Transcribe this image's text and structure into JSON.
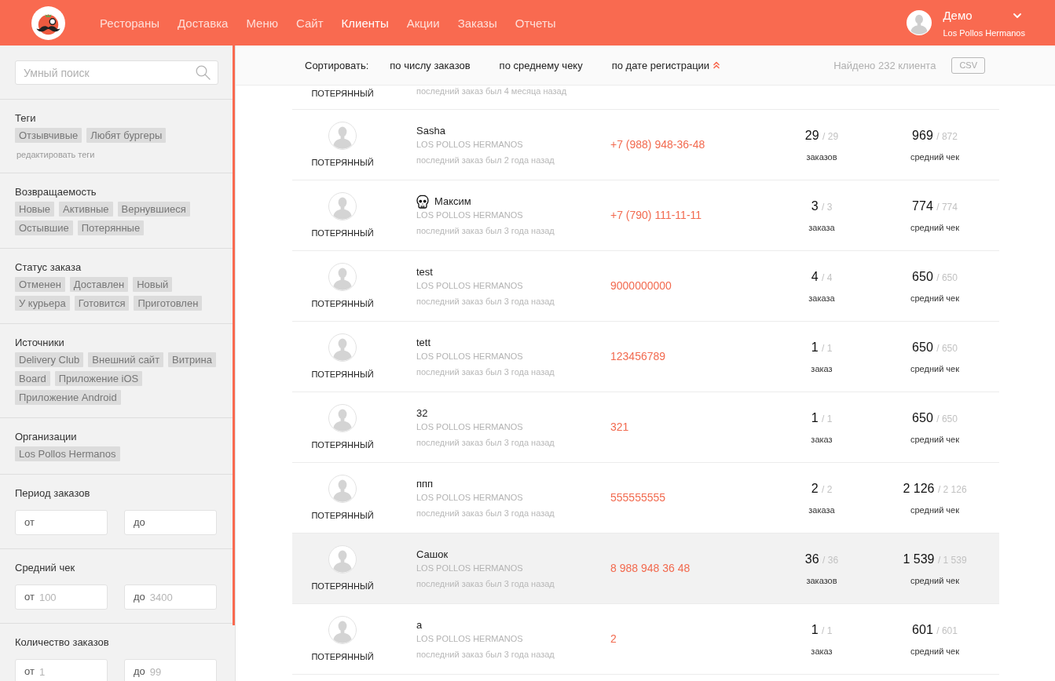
{
  "header": {
    "nav": [
      {
        "label": "Рестораны",
        "selected": false
      },
      {
        "label": "Доставка",
        "selected": false
      },
      {
        "label": "Меню",
        "selected": false
      },
      {
        "label": "Сайт",
        "selected": false
      },
      {
        "label": "Клиенты",
        "selected": true
      },
      {
        "label": "Акции",
        "selected": false
      },
      {
        "label": "Заказы",
        "selected": false
      },
      {
        "label": "Отчеты",
        "selected": false
      }
    ],
    "user": {
      "name": "Демо",
      "organization": "Los Pollos Hermanos"
    }
  },
  "sidebar": {
    "search": {
      "placeholder": "Умный поиск"
    },
    "filters": [
      {
        "kind": "tags",
        "title": "Теги",
        "tags": [
          "Отзывчивые",
          "Любят бургеры"
        ],
        "edit_link": "редактировать теги"
      },
      {
        "kind": "tags",
        "title": "Возвращаемость",
        "tags": [
          "Новые",
          "Активные",
          "Вернувшиеся",
          "Остывшие",
          "Потерянные"
        ]
      },
      {
        "kind": "tags",
        "title": "Статус заказа",
        "tags": [
          "Отменен",
          "Доставлен",
          "Новый",
          "У курьера",
          "Готовится",
          "Приготовлен"
        ]
      },
      {
        "kind": "tags",
        "title": "Источники",
        "tags": [
          "Delivery Club",
          "Внешний сайт",
          "Витрина",
          "Board",
          "Приложение iOS",
          "Приложение Android"
        ]
      },
      {
        "kind": "tags",
        "title": "Организации",
        "tags": [
          "Los Pollos Hermanos"
        ]
      },
      {
        "kind": "range",
        "title": "Период заказов",
        "fields": [
          {
            "prefix": "от"
          },
          {
            "prefix": "до"
          }
        ]
      },
      {
        "kind": "range",
        "title": "Средний чек",
        "fields": [
          {
            "prefix": "от",
            "placeholder": "100"
          },
          {
            "prefix": "до",
            "placeholder": "3400"
          }
        ]
      },
      {
        "kind": "range",
        "title": "Количество заказов",
        "fields": [
          {
            "prefix": "от",
            "placeholder": "1"
          },
          {
            "prefix": "до",
            "placeholder": "99"
          }
        ]
      }
    ]
  },
  "sort_bar": {
    "label": "Сортировать:",
    "options": [
      {
        "label": "по числу заказов",
        "selected": false
      },
      {
        "label": "по среднему чеку",
        "selected": false
      },
      {
        "label": "по дате регистрации",
        "selected": true
      }
    ],
    "found": "Найдено 232 клиента",
    "export_button": "CSV"
  },
  "clipped_row": {
    "status": "ПОТЕРЯННЫЙ",
    "last_order": "последний заказ был 4 месяца назад"
  },
  "clients": [
    {
      "name": "Sasha",
      "flagged": false,
      "company": "LOS POLLOS HERMANOS",
      "last_order": "последний заказ был 2 года назад",
      "status": "ПОТЕРЯННЫЙ",
      "phone": "+7 (988) 948-36-48",
      "orders": "29",
      "orders_all": "/ 29",
      "orders_label": "заказов",
      "avg": "969",
      "avg_all": "/ 872",
      "avg_label": "средний чек",
      "selected": false
    },
    {
      "name": "Максим",
      "flagged": true,
      "company": "LOS POLLOS HERMANOS",
      "last_order": "последний заказ был 3 года назад",
      "status": "ПОТЕРЯННЫЙ",
      "phone": "+7 (790) 111-11-11",
      "orders": "3",
      "orders_all": "/ 3",
      "orders_label": "заказа",
      "avg": "774",
      "avg_all": "/ 774",
      "avg_label": "средний чек",
      "selected": false
    },
    {
      "name": "test",
      "flagged": false,
      "company": "LOS POLLOS HERMANOS",
      "last_order": "последний заказ был 3 года назад",
      "status": "ПОТЕРЯННЫЙ",
      "phone": "9000000000",
      "orders": "4",
      "orders_all": "/ 4",
      "orders_label": "заказа",
      "avg": "650",
      "avg_all": "/ 650",
      "avg_label": "средний чек",
      "selected": false
    },
    {
      "name": "tett",
      "flagged": false,
      "company": "LOS POLLOS HERMANOS",
      "last_order": "последний заказ был 3 года назад",
      "status": "ПОТЕРЯННЫЙ",
      "phone": "123456789",
      "orders": "1",
      "orders_all": "/ 1",
      "orders_label": "заказ",
      "avg": "650",
      "avg_all": "/ 650",
      "avg_label": "средний чек",
      "selected": false
    },
    {
      "name": "32",
      "flagged": false,
      "company": "LOS POLLOS HERMANOS",
      "last_order": "последний заказ был 3 года назад",
      "status": "ПОТЕРЯННЫЙ",
      "phone": "321",
      "orders": "1",
      "orders_all": "/ 1",
      "orders_label": "заказ",
      "avg": "650",
      "avg_all": "/ 650",
      "avg_label": "средний чек",
      "selected": false
    },
    {
      "name": "ппп",
      "flagged": false,
      "company": "LOS POLLOS HERMANOS",
      "last_order": "последний заказ был 3 года назад",
      "status": "ПОТЕРЯННЫЙ",
      "phone": "555555555",
      "orders": "2",
      "orders_all": "/ 2",
      "orders_label": "заказа",
      "avg": "2 126",
      "avg_all": "/ 2 126",
      "avg_label": "средний чек",
      "selected": false
    },
    {
      "name": "Сашок",
      "flagged": false,
      "company": "LOS POLLOS HERMANOS",
      "last_order": "последний заказ был 3 года назад",
      "status": "ПОТЕРЯННЫЙ",
      "phone": "8 988 948 36 48",
      "orders": "36",
      "orders_all": "/ 36",
      "orders_label": "заказов",
      "avg": "1 539",
      "avg_all": "/ 1 539",
      "avg_label": "средний чек",
      "selected": true
    },
    {
      "name": "а",
      "flagged": false,
      "company": "LOS POLLOS HERMANOS",
      "last_order": "последний заказ был 3 года назад",
      "status": "ПОТЕРЯННЫЙ",
      "phone": "2",
      "orders": "1",
      "orders_all": "/ 1",
      "orders_label": "заказ",
      "avg": "601",
      "avg_all": "/ 601",
      "avg_label": "средний чек",
      "selected": false
    }
  ]
}
